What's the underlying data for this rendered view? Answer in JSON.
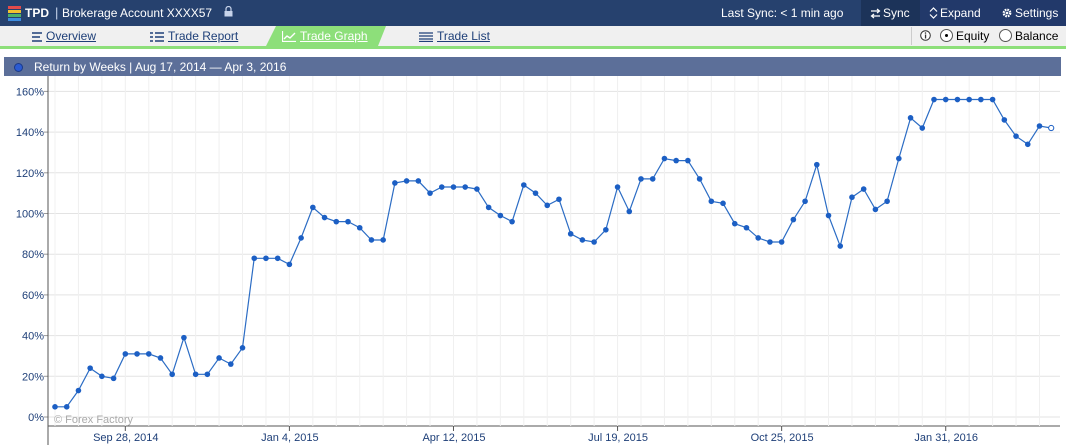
{
  "header": {
    "brand": "TPD",
    "account": "Brokerage Account XXXX57",
    "sync_status": "Last Sync: < 1 min ago",
    "sync_label": "Sync",
    "expand_label": "Expand",
    "settings_label": "Settings"
  },
  "tabs": [
    {
      "label": "Overview",
      "icon": "list-icon"
    },
    {
      "label": "Trade Report",
      "icon": "report-icon"
    },
    {
      "label": "Trade Graph",
      "icon": "line-chart-icon",
      "active": true
    },
    {
      "label": "Trade List",
      "icon": "list-lines-icon"
    }
  ],
  "view_mode": {
    "options": [
      "Equity",
      "Balance"
    ],
    "selected": "Equity"
  },
  "panel": {
    "title": "Return by Weeks | Aug 17, 2014 — Apr 3, 2016"
  },
  "colors": {
    "header_bg": "#26416e",
    "tab_active": "#8ddf7a",
    "panel_head": "#5c6f99",
    "line": "#2b6cc4"
  },
  "chart_data": {
    "type": "line",
    "watermark": "© Forex Factory",
    "y_ticks": [
      "0%",
      "20%",
      "40%",
      "60%",
      "80%",
      "100%",
      "120%",
      "140%",
      "160%"
    ],
    "ylim": [
      0,
      170
    ],
    "x_ticks": [
      "Sep 28, 2014",
      "Jan 4, 2015",
      "Apr 12, 2015",
      "Jul 19, 2015",
      "Oct 25, 2015",
      "Jan 31, 2016"
    ],
    "x_tick_week_index": [
      6,
      20,
      34,
      48,
      62,
      76
    ],
    "grid": true,
    "series": [
      {
        "values": [
          5,
          5,
          13,
          24,
          20,
          19,
          31,
          31,
          31,
          29,
          21,
          39,
          21,
          21,
          29,
          26,
          34,
          78,
          78,
          78,
          75,
          88,
          103,
          98,
          96,
          96,
          93,
          87,
          87,
          115,
          116,
          116,
          110,
          113,
          113,
          113,
          112,
          103,
          99,
          96,
          114,
          110,
          104,
          107,
          90,
          87,
          86,
          92,
          113,
          101,
          117,
          117,
          127,
          126,
          126,
          117,
          106,
          105,
          95,
          93,
          88,
          86,
          86,
          97,
          106,
          124,
          99,
          84,
          108,
          112,
          102,
          106,
          127,
          147,
          142,
          156,
          156,
          156,
          156,
          156,
          156,
          146,
          138,
          134,
          143,
          142
        ]
      }
    ]
  }
}
